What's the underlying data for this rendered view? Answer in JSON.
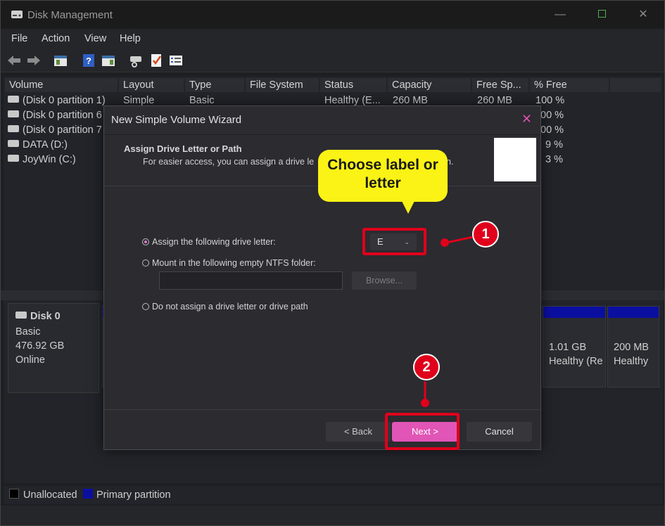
{
  "app": {
    "title": "Disk Management"
  },
  "menu": [
    "File",
    "Action",
    "View",
    "Help"
  ],
  "columns": [
    "Volume",
    "Layout",
    "Type",
    "File System",
    "Status",
    "Capacity",
    "Free Sp...",
    "% Free"
  ],
  "volumes": [
    {
      "volume": "(Disk 0 partition 1)",
      "layout": "Simple",
      "type": "Basic",
      "fs": "",
      "status": "Healthy (E...",
      "capacity": "260 MB",
      "free": "260 MB",
      "pct": "100 %"
    },
    {
      "volume": "(Disk 0 partition 6",
      "layout": "",
      "type": "",
      "fs": "",
      "status": "",
      "capacity": "",
      "free": "",
      "pct": "00 %"
    },
    {
      "volume": "(Disk 0 partition 7",
      "layout": "",
      "type": "",
      "fs": "",
      "status": "",
      "capacity": "",
      "free": "",
      "pct": "00 %"
    },
    {
      "volume": "DATA (D:)",
      "layout": "",
      "type": "",
      "fs": "",
      "status": "",
      "capacity": "",
      "free": "",
      "pct": "9 %"
    },
    {
      "volume": "JoyWin (C:)",
      "layout": "",
      "type": "",
      "fs": "",
      "status": "",
      "capacity": "",
      "free": "",
      "pct": "3 %"
    }
  ],
  "disk": {
    "name": "Disk 0",
    "kind": "Basic",
    "size": "476.92 GB",
    "state": "Online"
  },
  "partitions": [
    {
      "line1": "1.01 GB",
      "line2": "Healthy (Re"
    },
    {
      "line1": "200 MB",
      "line2": "Healthy"
    }
  ],
  "legend": {
    "unallocated": "Unallocated",
    "primary": "Primary partition"
  },
  "dialog": {
    "title": "New Simple Volume Wizard",
    "heading": "Assign Drive Letter or Path",
    "subheading": "For easier access, you can assign a drive le",
    "subheading_tail": "n.",
    "opt_assign": "Assign the following drive letter:",
    "drive_letter": "E",
    "opt_mount": "Mount in the following empty NTFS folder:",
    "browse": "Browse...",
    "opt_none": "Do not assign a drive letter or drive path",
    "back": "< Back",
    "next": "Next >",
    "cancel": "Cancel"
  },
  "annotations": {
    "callout": "Choose label or letter",
    "step1": "1",
    "step2": "2"
  },
  "colors": {
    "accent": "#e155b6",
    "annotation_red": "#e0001b",
    "callout_yellow": "#fbf315",
    "primary_partition": "#0b0fa0"
  }
}
